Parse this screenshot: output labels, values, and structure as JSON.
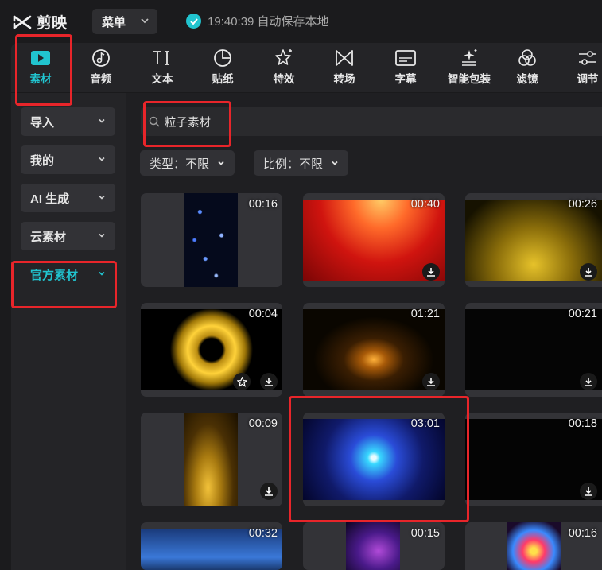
{
  "app": {
    "name": "剪映"
  },
  "header": {
    "menu_label": "菜单",
    "save_status": "19:40:39 自动保存本地"
  },
  "toolbar": [
    {
      "id": "media",
      "label": "素材",
      "icon": "media-play-icon",
      "active": true
    },
    {
      "id": "audio",
      "label": "音频",
      "icon": "music-note-icon"
    },
    {
      "id": "text",
      "label": "文本",
      "icon": "text-ti-icon"
    },
    {
      "id": "sticker",
      "label": "贴纸",
      "icon": "sticker-icon"
    },
    {
      "id": "effects",
      "label": "特效",
      "icon": "star-sparkle-icon"
    },
    {
      "id": "transition",
      "label": "转场",
      "icon": "bowtie-icon"
    },
    {
      "id": "captions",
      "label": "字幕",
      "icon": "subtitle-icon"
    },
    {
      "id": "smart-pack",
      "label": "智能包装",
      "icon": "magic-wand-icon"
    },
    {
      "id": "filters",
      "label": "滤镜",
      "icon": "filter-circles-icon"
    },
    {
      "id": "adjust",
      "label": "调节",
      "icon": "sliders-icon"
    }
  ],
  "sidebar": [
    {
      "label": "导入"
    },
    {
      "label": "我的"
    },
    {
      "label": "AI 生成"
    },
    {
      "label": "云素材"
    },
    {
      "label": "官方素材",
      "active": true
    }
  ],
  "search": {
    "value": "粒子素材"
  },
  "filters": [
    {
      "label": "类型：不限"
    },
    {
      "label": "比例：不限"
    }
  ],
  "grid": [
    {
      "duration": "00:16",
      "orientation": "portrait",
      "theme": "blue-stars"
    },
    {
      "duration": "00:40",
      "orientation": "landscape",
      "theme": "red-rays"
    },
    {
      "duration": "00:26",
      "orientation": "landscape",
      "theme": "gold-dust"
    },
    {
      "duration": "00:04",
      "orientation": "landscape",
      "theme": "gold-burst",
      "favorite": true
    },
    {
      "duration": "01:21",
      "orientation": "landscape",
      "theme": "gold-orb"
    },
    {
      "duration": "00:21",
      "orientation": "landscape",
      "theme": "dark-dots"
    },
    {
      "duration": "00:09",
      "orientation": "portrait",
      "theme": "gold-spiral"
    },
    {
      "duration": "03:01",
      "orientation": "landscape",
      "theme": "blue-warp"
    },
    {
      "duration": "00:18",
      "orientation": "landscape",
      "theme": "dark-dots"
    },
    {
      "duration": "00:32",
      "orientation": "landscape",
      "theme": "blue-rain"
    },
    {
      "duration": "00:15",
      "orientation": "portrait",
      "theme": "purple-swirl"
    },
    {
      "duration": "00:16",
      "orientation": "portrait",
      "theme": "confetti-burst"
    }
  ],
  "colors": {
    "accent": "#21c4cf",
    "highlight": "#e8252a",
    "background": "#1b1b1d"
  }
}
